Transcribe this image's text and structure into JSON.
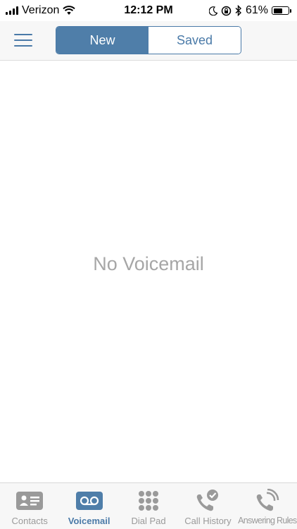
{
  "status_bar": {
    "carrier": "Verizon",
    "time": "12:12 PM",
    "battery_percent": "61%",
    "battery_level": 0.61,
    "icons": [
      "signal-icon",
      "wifi-icon",
      "moon-icon",
      "rotation-lock-icon",
      "bluetooth-icon",
      "battery-icon"
    ]
  },
  "header": {
    "menu_icon": "hamburger-menu-icon",
    "segments": [
      {
        "label": "New",
        "selected": true
      },
      {
        "label": "Saved",
        "selected": false
      }
    ]
  },
  "main": {
    "empty_message": "No Voicemail"
  },
  "tab_bar": {
    "items": [
      {
        "label": "Contacts",
        "icon": "contact-card-icon",
        "active": false
      },
      {
        "label": "Voicemail",
        "icon": "voicemail-icon",
        "active": true
      },
      {
        "label": "Dial Pad",
        "icon": "dial-pad-icon",
        "active": false
      },
      {
        "label": "Call History",
        "icon": "call-history-icon",
        "active": false
      },
      {
        "label": "Answering Rules",
        "icon": "answering-rules-icon",
        "active": false
      }
    ]
  },
  "colors": {
    "accent": "#4f7ea9",
    "inactive_icon": "#9a9a9a",
    "empty_text": "#a6a6a6"
  }
}
